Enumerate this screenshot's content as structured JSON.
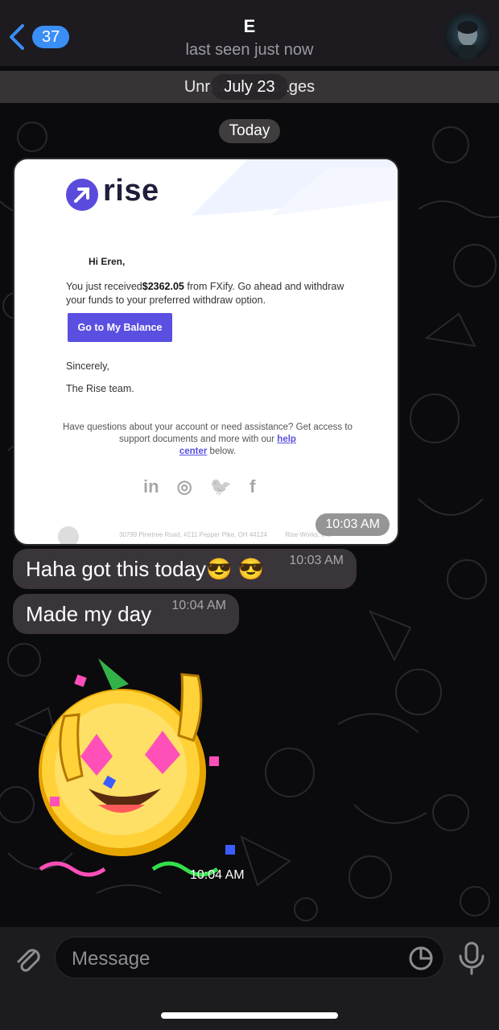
{
  "header": {
    "back_count": "37",
    "title": "E",
    "subtitle": "last seen just now"
  },
  "banner": {
    "unread_text": "Unread messages",
    "date_overlay": "July 23"
  },
  "date_chip": "Today",
  "email_card": {
    "brand": "rise",
    "greeting": "Hi Eren,",
    "body_prefix": "You just received",
    "amount": "$2362.05",
    "body_suffix": "from FXify. Go ahead and withdraw your funds to your preferred withdraw option.",
    "cta": "Go to My Balance",
    "sincerely": "Sincerely,",
    "team": "The Rise team.",
    "help_text": "Have questions about your account or need assistance? Get access to support documents and more with our",
    "help_link_1": "help",
    "help_link_2": "center",
    "help_end": " below.",
    "socials": [
      "in",
      "◎",
      "🐦",
      "f"
    ],
    "address": "30799 Pinetree Road, #211 Pepper Pike, OH 44124",
    "company": "Rise Works, Inc.",
    "time": "10:03 AM"
  },
  "messages": [
    {
      "text": "Haha got this today😎 😎",
      "time": "10:03 AM"
    },
    {
      "text": "Made my day",
      "time": "10:04 AM"
    }
  ],
  "sticker": {
    "time": "10:04 AM",
    "icon": "party-coin-sticker"
  },
  "composer": {
    "placeholder": "Message"
  },
  "colors": {
    "accent": "#3a8ef6",
    "bubble": "#3a353a",
    "rise_purple": "#5a4fe0"
  }
}
